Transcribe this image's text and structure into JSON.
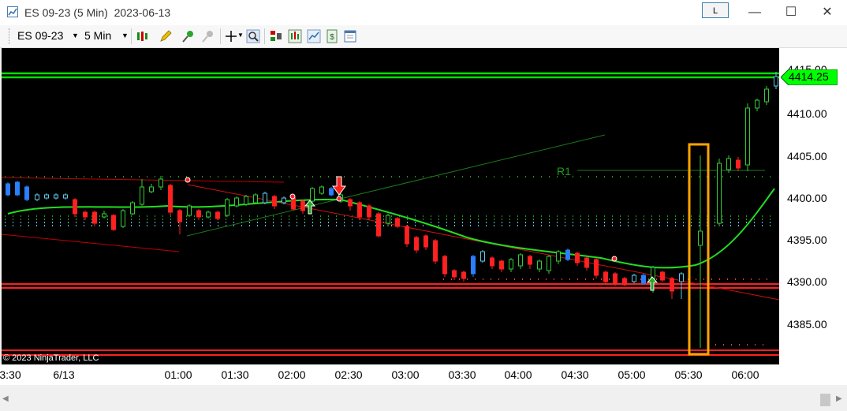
{
  "window": {
    "title": "ES 09-23 (5 Min)  2023-06-13",
    "link_button": "L",
    "minimize": "—",
    "maximize": "☐",
    "close": "✕"
  },
  "toolbar": {
    "instrument": "ES 09-23",
    "interval": "5 Min",
    "icons": [
      "bar-type-icon",
      "drawing-tool-icon",
      "pin-icon",
      "pin-disabled-icon",
      "crosshair-icon",
      "zoom-icon",
      "strategies-icon",
      "indicators-icon",
      "chart-style-icon",
      "order-icon",
      "properties-icon"
    ]
  },
  "chart": {
    "copyright": "© 2023 NinjaTrader, LLC",
    "last_price": "4414.25",
    "pivot_label": "R1",
    "y_ticks": [
      "4415.00",
      "4410.00",
      "4405.00",
      "4400.00",
      "4395.00",
      "4390.00",
      "4385.00"
    ],
    "x_ticks": [
      "3:30",
      "6/13",
      "01:00",
      "01:30",
      "02:00",
      "02:30",
      "03:00",
      "03:30",
      "04:00",
      "04:30",
      "05:00",
      "05:30",
      "06:00"
    ],
    "colors": {
      "background": "#000000",
      "resistance_line": "#00e000",
      "support_line": "#ff2020",
      "highlight_box": "#ffa500",
      "moving_average": "#22dd22",
      "price_tag": "#00ff00"
    }
  }
}
